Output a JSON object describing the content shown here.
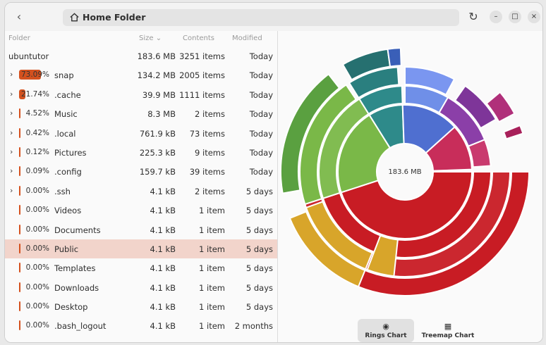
{
  "header": {
    "back_icon": "chevron-left-icon",
    "title": "Home Folder",
    "reload_icon": "reload-icon",
    "min_label": "–",
    "max_label": "□",
    "close_label": "×"
  },
  "columns": {
    "folder": "Folder",
    "size": "Size",
    "contents": "Contents",
    "modified": "Modified"
  },
  "rows": [
    {
      "name": "ubuntutor",
      "pct": "",
      "size": "183.6 MB",
      "contents": "3251 items",
      "modified": "Today",
      "root": true
    },
    {
      "name": "snap",
      "pct": "73.09%",
      "fill_fraction": 0.7309,
      "size": "134.2 MB",
      "contents": "2005 items",
      "modified": "Today",
      "expandable": true
    },
    {
      "name": ".cache",
      "pct": "21.74%",
      "fill_fraction": 0.2174,
      "size": "39.9 MB",
      "contents": "1111 items",
      "modified": "Today",
      "expandable": true
    },
    {
      "name": "Music",
      "pct": "4.52%",
      "fill_fraction": 0.0452,
      "size": "8.3 MB",
      "contents": "2 items",
      "modified": "Today",
      "expandable": true
    },
    {
      "name": ".local",
      "pct": "0.42%",
      "fill_fraction": 0.0042,
      "size": "761.9 kB",
      "contents": "73 items",
      "modified": "Today",
      "expandable": true
    },
    {
      "name": "Pictures",
      "pct": "0.12%",
      "fill_fraction": 0.0012,
      "size": "225.3 kB",
      "contents": "9 items",
      "modified": "Today",
      "expandable": true
    },
    {
      "name": ".config",
      "pct": "0.09%",
      "fill_fraction": 0.0009,
      "size": "159.7 kB",
      "contents": "39 items",
      "modified": "Today",
      "expandable": true
    },
    {
      "name": ".ssh",
      "pct": "0.00%",
      "fill_fraction": 0,
      "size": "4.1 kB",
      "contents": "2 items",
      "modified": "5 days",
      "expandable": true
    },
    {
      "name": "Videos",
      "pct": "0.00%",
      "fill_fraction": 0,
      "size": "4.1 kB",
      "contents": "1 item",
      "modified": "5 days"
    },
    {
      "name": "Documents",
      "pct": "0.00%",
      "fill_fraction": 0,
      "size": "4.1 kB",
      "contents": "1 item",
      "modified": "5 days"
    },
    {
      "name": "Public",
      "pct": "0.00%",
      "fill_fraction": 0,
      "size": "4.1 kB",
      "contents": "1 item",
      "modified": "5 days",
      "selected": true
    },
    {
      "name": "Templates",
      "pct": "0.00%",
      "fill_fraction": 0,
      "size": "4.1 kB",
      "contents": "1 item",
      "modified": "5 days"
    },
    {
      "name": "Downloads",
      "pct": "0.00%",
      "fill_fraction": 0,
      "size": "4.1 kB",
      "contents": "1 item",
      "modified": "5 days"
    },
    {
      "name": "Desktop",
      "pct": "0.00%",
      "fill_fraction": 0,
      "size": "4.1 kB",
      "contents": "1 item",
      "modified": "5 days"
    },
    {
      "name": ".bash_logout",
      "pct": "0.00%",
      "fill_fraction": 0,
      "size": "4.1 kB",
      "contents": "1 item",
      "modified": "2 months"
    }
  ],
  "colors": {
    "bar_fill": "#d4511e",
    "snap": "#c81c24",
    "cache": "#7ab848",
    "music": "#2e8a8a",
    "local": "#4f6fd0",
    "pictures": "#8b3fa8",
    "config": "#c93a6e",
    "selected_row": "#f2d4cb"
  },
  "chart": {
    "center_label": "183.6 MB"
  },
  "view_switcher": [
    {
      "label": "Rings Chart",
      "icon": "rings-chart-icon",
      "active": true
    },
    {
      "label": "Treemap Chart",
      "icon": "treemap-chart-icon",
      "active": false
    }
  ]
}
